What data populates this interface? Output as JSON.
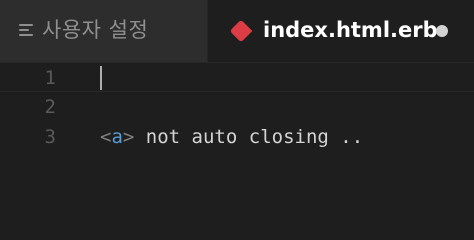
{
  "tabs": {
    "settings": {
      "label": "사용자 설정",
      "icon": "settings-lines-icon"
    },
    "file": {
      "label": "index.html.erb",
      "icon": "ruby-icon",
      "dirty_icon": "unsaved-dot-icon"
    }
  },
  "editor": {
    "lines": [
      {
        "number": "1",
        "text": ""
      },
      {
        "number": "2",
        "text": ""
      },
      {
        "number": "3",
        "text": "<a> not auto closing .."
      }
    ],
    "line3_tokens": {
      "open": "<",
      "tag": "a",
      "close": ">",
      "rest": " not auto closing .."
    }
  },
  "colors": {
    "background": "#1e1e1e",
    "tab_inactive": "#2d2d2d",
    "ruby": "#dc3d45",
    "tag": "#569cd6",
    "punctuation": "#808080"
  }
}
